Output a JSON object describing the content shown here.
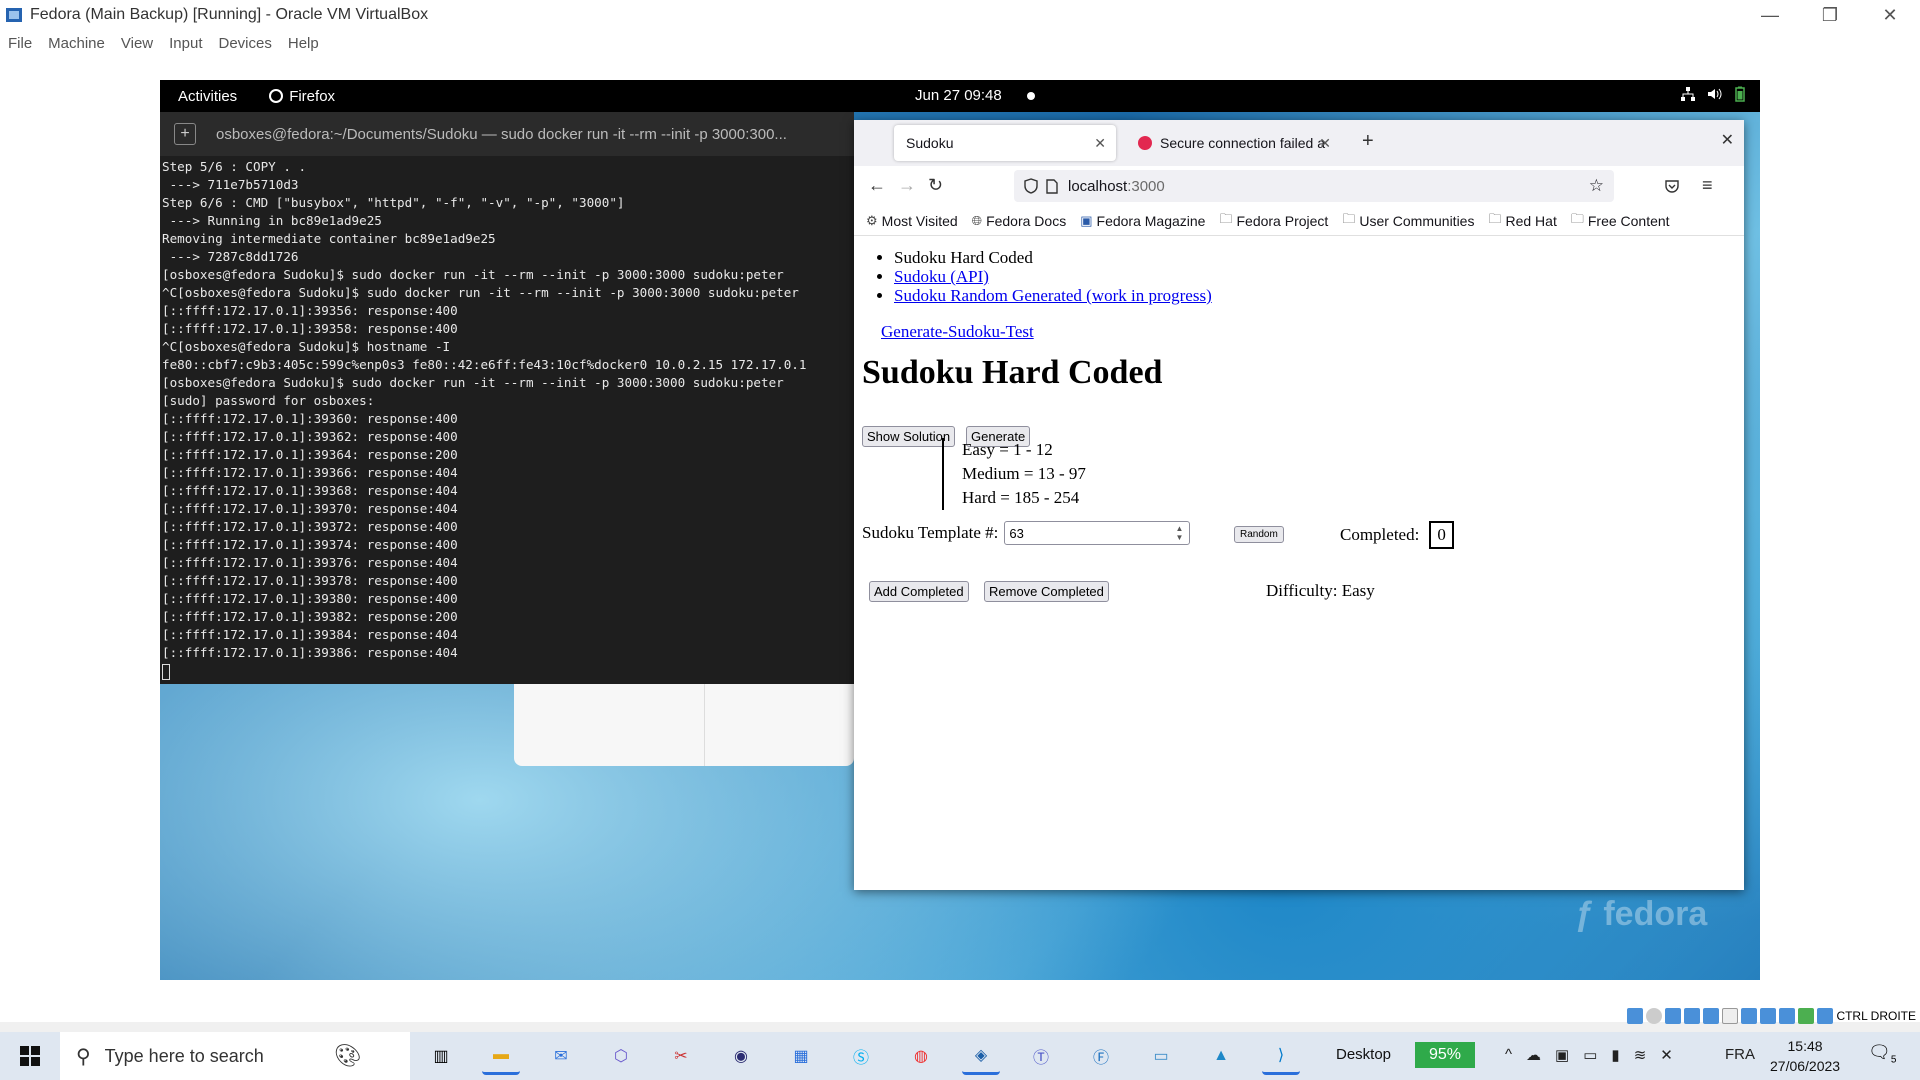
{
  "host_window": {
    "title": "Fedora (Main Backup) [Running] - Oracle VM VirtualBox",
    "menu": [
      "File",
      "Machine",
      "View",
      "Input",
      "Devices",
      "Help"
    ]
  },
  "gnome": {
    "activities": "Activities",
    "app": "Firefox",
    "clock": "Jun 27  09:48"
  },
  "terminal": {
    "title": "osboxes@fedora:~/Documents/Sudoku — sudo docker run -it --rm --init -p 3000:300...",
    "lines": [
      "Step 5/6 : COPY . .",
      " ---> 711e7b5710d3",
      "Step 6/6 : CMD [\"busybox\", \"httpd\", \"-f\", \"-v\", \"-p\", \"3000\"]",
      " ---> Running in bc89e1ad9e25",
      "Removing intermediate container bc89e1ad9e25",
      " ---> 7287c8dd1726",
      "[osboxes@fedora Sudoku]$ sudo docker run -it --rm --init -p 3000:3000 sudoku:peter",
      "^C[osboxes@fedora Sudoku]$ sudo docker run -it --rm --init -p 3000:3000 sudoku:peter",
      "[::ffff:172.17.0.1]:39356: response:400",
      "[::ffff:172.17.0.1]:39358: response:400",
      "^C[osboxes@fedora Sudoku]$ hostname -I",
      "fe80::cbf7:c9b3:405c:599c%enp0s3 fe80::42:e6ff:fe43:10cf%docker0 10.0.2.15 172.17.0.1",
      "[osboxes@fedora Sudoku]$ sudo docker run -it --rm --init -p 3000:3000 sudoku:peter",
      "[sudo] password for osboxes:",
      "[::ffff:172.17.0.1]:39360: response:400",
      "[::ffff:172.17.0.1]:39362: response:400",
      "[::ffff:172.17.0.1]:39364: response:200",
      "[::ffff:172.17.0.1]:39366: response:404",
      "[::ffff:172.17.0.1]:39368: response:404",
      "[::ffff:172.17.0.1]:39370: response:404",
      "[::ffff:172.17.0.1]:39372: response:400",
      "[::ffff:172.17.0.1]:39374: response:400",
      "[::ffff:172.17.0.1]:39376: response:404",
      "[::ffff:172.17.0.1]:39378: response:400",
      "[::ffff:172.17.0.1]:39380: response:400",
      "[::ffff:172.17.0.1]:39382: response:200",
      "[::ffff:172.17.0.1]:39384: response:404",
      "[::ffff:172.17.0.1]:39386: response:404"
    ]
  },
  "firefox": {
    "tab_active": "Sudoku",
    "tab_inactive": "Secure connection failed a",
    "url_host": "localhost",
    "url_port": ":3000",
    "bookmarks": [
      "Most Visited",
      "Fedora Docs",
      "Fedora Magazine",
      "Fedora Project",
      "User Communities",
      "Red Hat",
      "Free Content"
    ]
  },
  "page": {
    "nav": [
      "Sudoku Hard Coded",
      "Sudoku (API)",
      "Sudoku Random Generated (work in progress)"
    ],
    "generate_link": "Generate-Sudoku-Test",
    "heading": "Sudoku Hard Coded",
    "show_solution": "Show Solution",
    "generate": "Generate",
    "levels": [
      "Easy = 1 - 12",
      "Medium = 13 - 97",
      "Hard = 185 - 254"
    ],
    "template_label": "Sudoku Template #:",
    "template_value": "63",
    "random": "Random",
    "completed_label": "Completed:",
    "completed_value": "0",
    "add_completed": "Add Completed",
    "remove_completed": "Remove Completed",
    "difficulty": "Difficulty: Easy"
  },
  "vbox_status": {
    "host_key": "CTRL DROITE"
  },
  "taskbar": {
    "search_placeholder": "Type here to search",
    "desktop": "Desktop",
    "battery": "95%",
    "lang": "FRA",
    "time": "15:48",
    "date": "27/06/2023",
    "notifications": "5"
  },
  "colors": {
    "link": "#0000ee",
    "battery": "#2faa4a",
    "terminal_bg": "#1e1e1e"
  }
}
